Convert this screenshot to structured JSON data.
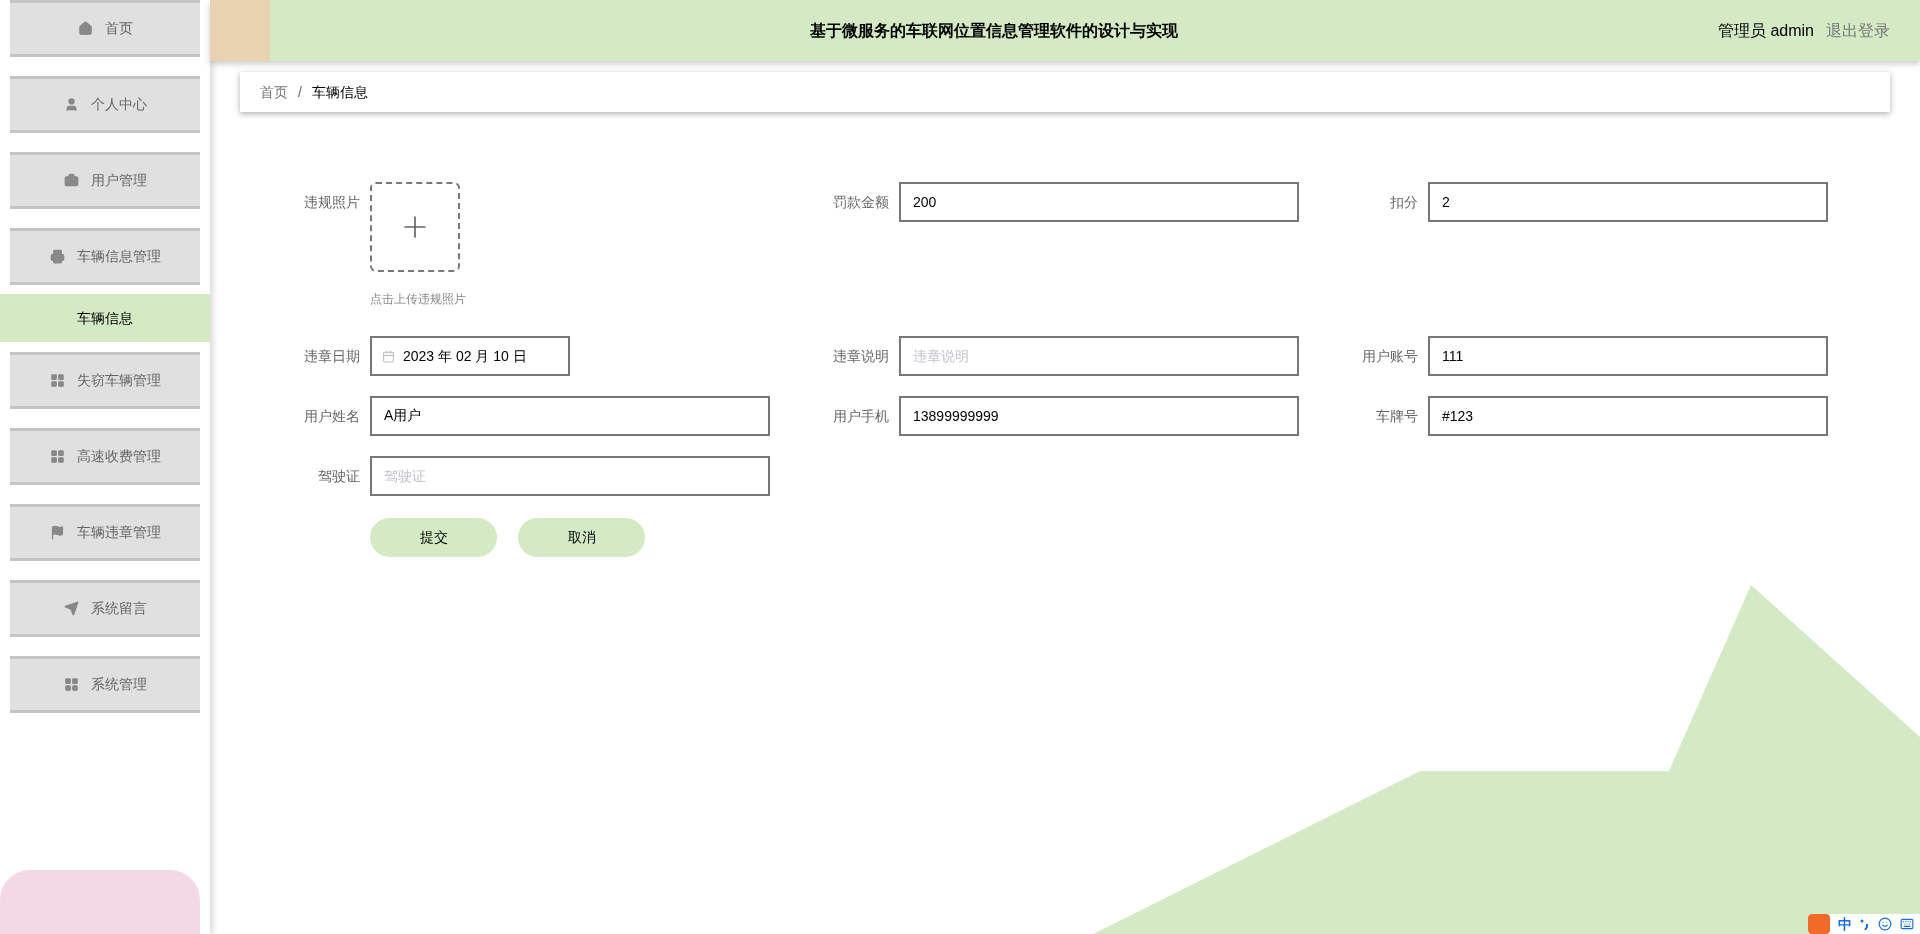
{
  "header": {
    "title": "基于微服务的车联网位置信息管理软件的设计与实现",
    "user": "管理员 admin",
    "logout": "退出登录"
  },
  "sidebar": {
    "items": [
      {
        "label": "首页",
        "selected": false
      },
      {
        "label": "个人中心",
        "selected": false
      },
      {
        "label": "用户管理",
        "selected": false
      },
      {
        "label": "车辆信息管理",
        "selected": false,
        "children": [
          {
            "label": "车辆信息",
            "selected": true
          }
        ]
      },
      {
        "label": "失窃车辆管理",
        "selected": false
      },
      {
        "label": "高速收费管理",
        "selected": false
      },
      {
        "label": "车辆违章管理",
        "selected": false
      },
      {
        "label": "系统留言",
        "selected": false
      },
      {
        "label": "系统管理",
        "selected": false
      }
    ]
  },
  "breadcrumb": {
    "items": [
      "首页",
      "车辆信息"
    ],
    "separator": "/"
  },
  "form": {
    "rows": [
      [
        {
          "kind": "upload",
          "label": "违规照片",
          "hint": "点击上传违规照片"
        },
        {
          "kind": "text",
          "label": "罚款金额",
          "value": "200"
        },
        {
          "kind": "text",
          "label": "扣分",
          "value": "2"
        }
      ],
      [
        {
          "kind": "date",
          "label": "违章日期",
          "value": "2023 年 02 月 10 日"
        },
        {
          "kind": "text",
          "label": "违章说明",
          "placeholder": "违章说明"
        },
        {
          "kind": "text",
          "label": "用户账号",
          "value": "111"
        }
      ],
      [
        {
          "kind": "text",
          "label": "用户姓名",
          "value": "A用户"
        },
        {
          "kind": "text",
          "label": "用户手机",
          "value": "13899999999"
        },
        {
          "kind": "text",
          "label": "车牌号",
          "value": "#123"
        }
      ],
      [
        {
          "kind": "text",
          "label": "驾驶证",
          "placeholder": "驾驶证"
        }
      ]
    ],
    "buttons": [
      "提交",
      "取消"
    ]
  },
  "ime": {
    "label": "中"
  }
}
